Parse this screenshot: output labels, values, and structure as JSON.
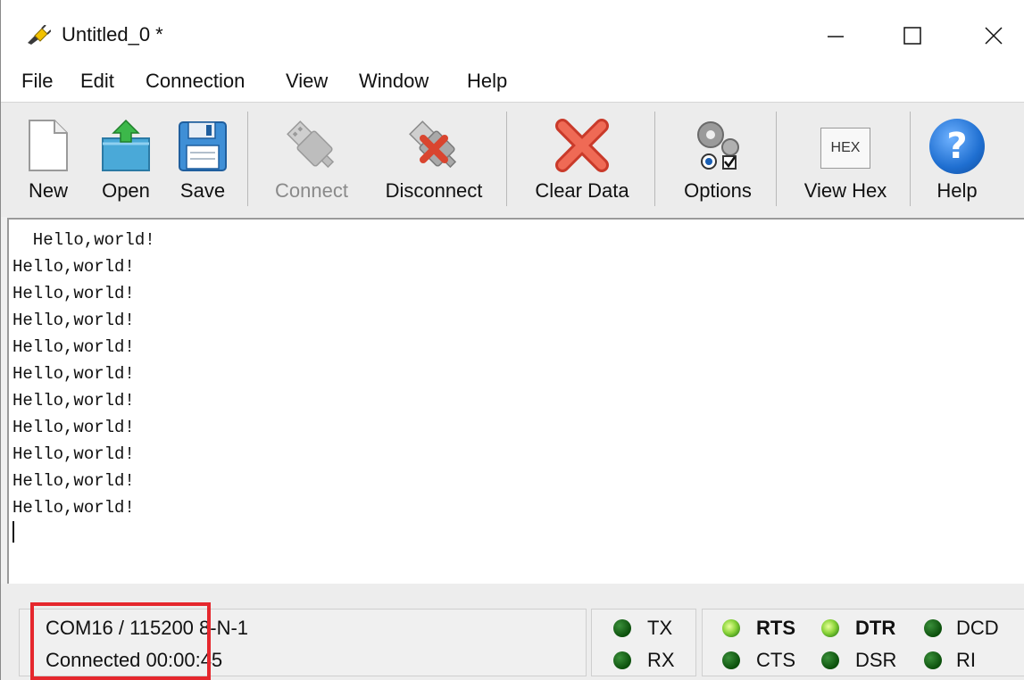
{
  "window": {
    "title": "Untitled_0 *",
    "controls": {
      "minimize": "minimize-icon",
      "maximize": "maximize-icon",
      "close": "close-icon"
    }
  },
  "menu": [
    "File",
    "Edit",
    "Connection",
    "View",
    "Window",
    "Help"
  ],
  "toolbar": {
    "new_label": "New",
    "open_label": "Open",
    "save_label": "Save",
    "connect_label": "Connect",
    "disconnect_label": "Disconnect",
    "clear_label": "Clear Data",
    "options_label": "Options",
    "viewhex_label": "View Hex",
    "viewhex_icon_text": "HEX",
    "help_label": "Help",
    "help_icon_text": "?"
  },
  "terminal": {
    "lines": [
      "  Hello,world!",
      "Hello,world!",
      "Hello,world!",
      "Hello,world!",
      "Hello,world!",
      "Hello,world!",
      "Hello,world!",
      "Hello,world!",
      "Hello,world!",
      "Hello,world!",
      "Hello,world!"
    ]
  },
  "status": {
    "port_info": "COM16 / 115200 8-N-1",
    "connection": "Connected 00:00:45"
  },
  "signals": {
    "tx": {
      "label": "TX",
      "on": false
    },
    "rx": {
      "label": "RX",
      "on": false
    },
    "rts": {
      "label": "RTS",
      "on": true
    },
    "cts": {
      "label": "CTS",
      "on": false
    },
    "dtr": {
      "label": "DTR",
      "on": true
    },
    "dsr": {
      "label": "DSR",
      "on": false
    },
    "dcd": {
      "label": "DCD",
      "on": false
    },
    "ri": {
      "label": "RI",
      "on": false
    }
  },
  "colors": {
    "highlight": "#e5272d",
    "led_on": "#8bd43a",
    "led_off": "#0b4f0b",
    "help_icon": "#1f6fd1",
    "clear_icon": "#e04a3a"
  }
}
